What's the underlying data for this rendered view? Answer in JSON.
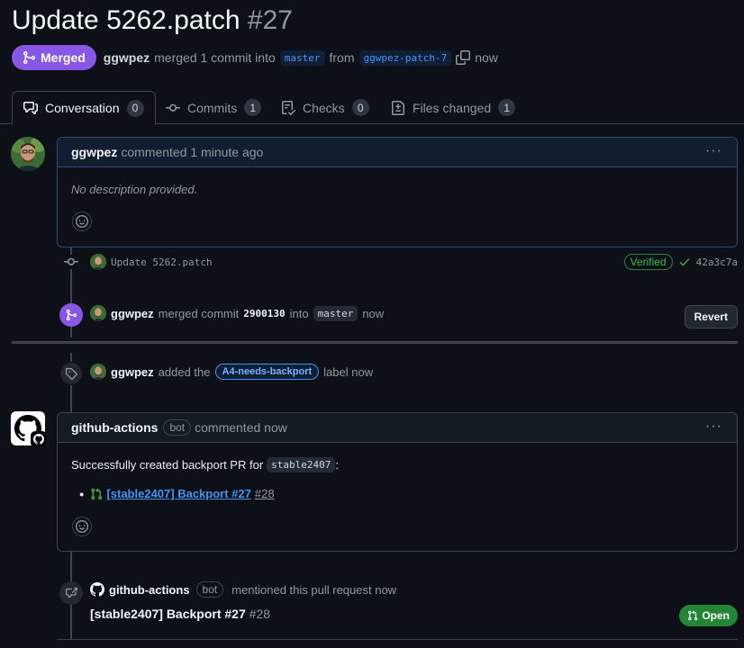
{
  "pr": {
    "title": "Update 5262.patch",
    "number": "#27",
    "state": "Merged",
    "author": "ggwpez",
    "action_text": "merged 1 commit into",
    "base_branch": "master",
    "from_text": "from",
    "head_branch": "ggwpez-patch-7",
    "time": "now"
  },
  "tabs": [
    {
      "label": "Conversation",
      "count": "0",
      "icon": "comment-discussion-icon"
    },
    {
      "label": "Commits",
      "count": "1",
      "icon": "git-commit-icon"
    },
    {
      "label": "Checks",
      "count": "0",
      "icon": "checklist-icon"
    },
    {
      "label": "Files changed",
      "count": "1",
      "icon": "file-diff-icon"
    }
  ],
  "comment1": {
    "author": "ggwpez",
    "meta": "commented 1 minute ago",
    "body": "No description provided."
  },
  "commit": {
    "message": "Update 5262.patch",
    "verified": "Verified",
    "sha": "42a3c7a"
  },
  "merge_event": {
    "author": "ggwpez",
    "text_merged": "merged commit",
    "sha": "2900130",
    "text_into": "into",
    "branch": "master",
    "time": "now",
    "revert_label": "Revert"
  },
  "label_event": {
    "author": "ggwpez",
    "text_added": "added the",
    "label": "A4-needs-backport",
    "text_label": "label now"
  },
  "comment2": {
    "author": "github-actions",
    "bot": "bot",
    "meta": "commented now",
    "body_prefix": "Successfully created backport PR for",
    "body_code": "stable2407",
    "body_suffix": ":",
    "list_link": "[stable2407] Backport #27",
    "list_num": "#28"
  },
  "mention_event": {
    "author": "github-actions",
    "bot": "bot",
    "text": "mentioned this pull request now",
    "pr_title": "[stable2407] Backport #27",
    "pr_num": "#28",
    "status": "Open"
  },
  "colors": {
    "merged": "#8957e5",
    "open": "#238636",
    "link": "#4493f8",
    "background": "#0d1117"
  }
}
